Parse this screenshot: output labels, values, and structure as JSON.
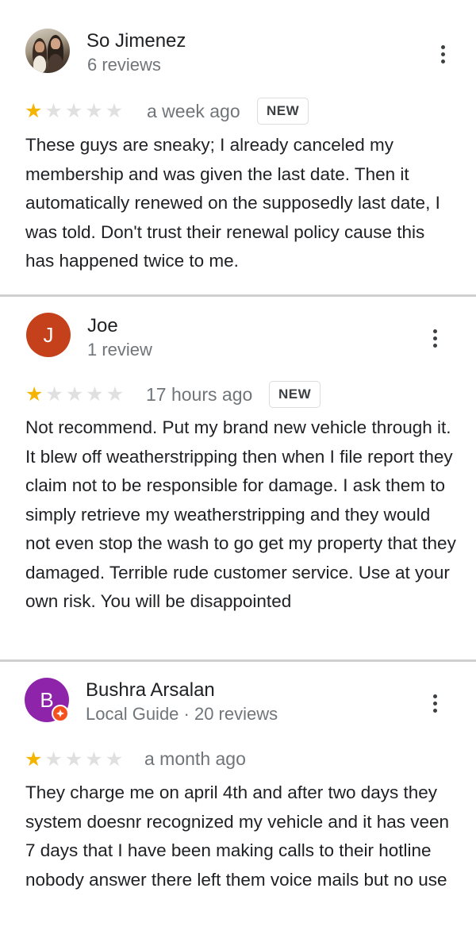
{
  "reviews": [
    {
      "name": "So Jimenez",
      "meta": "6 reviews",
      "rating": 1,
      "date": "a week ago",
      "badge": "NEW",
      "text": "These guys are sneaky; I already canceled my membership and was given the last date. Then it automatically renewed on the supposedly last date, I was told. Don't trust their renewal policy cause this has happened twice to me."
    },
    {
      "name": "Joe",
      "meta": "1 review",
      "avatar_letter": "J",
      "avatar_color": "#c5411b",
      "rating": 1,
      "date": "17 hours ago",
      "badge": "NEW",
      "text": "Not recommend.  Put my brand new vehicle through it. It blew off weatherstripping then when I file report they claim not to be responsible for damage.  I ask them to simply retrieve my weatherstripping and they would not even stop the wash to go get my property that they damaged.   Terrible rude customer service. Use at your own risk.  You will be disappointed"
    },
    {
      "name": "Bushra Arsalan",
      "meta": "Local Guide · 20 reviews",
      "avatar_letter": "B",
      "avatar_color": "#8e24aa",
      "rating": 1,
      "date": "a month ago",
      "text": "They charge me on april 4th and after two days they system doesnr recognized my vehicle and it has veen 7 days that I have been making calls to their hotline nobody answer there left them voice mails but no use"
    }
  ],
  "icons": {
    "star": "★",
    "more": "more-vert-icon",
    "local_guide": "local-guide-badge-icon"
  },
  "colors": {
    "star_filled": "#f4b400",
    "star_empty": "#e0e0e0",
    "secondary_text": "#70757a"
  }
}
